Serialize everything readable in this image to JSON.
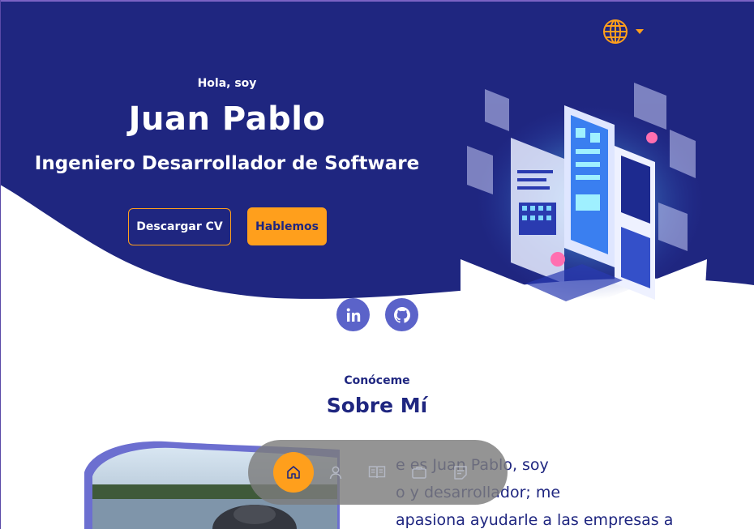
{
  "colors": {
    "primary": "#1f2680",
    "accent": "#ff9f1c",
    "social_bg": "#5b63c9",
    "dock_bg": "#7d7d7d"
  },
  "header": {
    "language_icon": "globe-icon",
    "language_caret": "caret-down-icon"
  },
  "hero": {
    "greeting": "Hola, soy",
    "name": "Juan Pablo",
    "role": "Ingeniero Desarrollador de Software",
    "download_cv_label": "Descargar CV",
    "contact_label": "Hablemos",
    "illustration": "isometric-phone-app-illustration"
  },
  "social": [
    {
      "icon": "linkedin-icon"
    },
    {
      "icon": "github-icon"
    }
  ],
  "about": {
    "eyebrow": "Conóceme",
    "title": "Sobre Mí",
    "lines": [
      "e es Juan Pablo, soy",
      "o y desarrollador; me",
      "apasiona ayudarle a las empresas a"
    ]
  },
  "dock": {
    "active_index": 0,
    "items": [
      {
        "icon": "home-icon"
      },
      {
        "icon": "user-icon"
      },
      {
        "icon": "book-icon"
      },
      {
        "icon": "briefcase-icon"
      },
      {
        "icon": "message-icon"
      }
    ]
  }
}
